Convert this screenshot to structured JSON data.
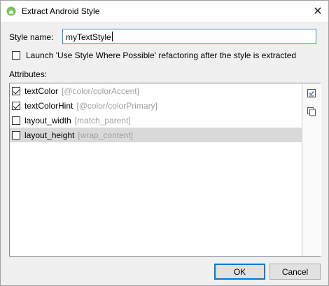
{
  "window": {
    "title": "Extract Android Style",
    "close_glyph": "✕"
  },
  "style_name": {
    "label": "Style name:",
    "value": "myTextStyle"
  },
  "launch_refactor": {
    "label": "Launch 'Use Style Where Possible' refactoring after the style is extracted",
    "checked": false
  },
  "attributes": {
    "label": "Attributes:",
    "items": [
      {
        "name": "textColor",
        "value": "[@color/colorAccent]",
        "checked": true,
        "selected": false
      },
      {
        "name": "textColorHint",
        "value": "[@color/colorPrimary]",
        "checked": true,
        "selected": false
      },
      {
        "name": "layout_width",
        "value": "[match_parent]",
        "checked": false,
        "selected": false
      },
      {
        "name": "layout_height",
        "value": "[wrap_content]",
        "checked": false,
        "selected": true
      }
    ]
  },
  "side_toolbar": {
    "icons": [
      "select-all-icon",
      "copy-icon"
    ]
  },
  "buttons": {
    "ok": "OK",
    "cancel": "Cancel"
  },
  "colors": {
    "accent_border": "#0078d7",
    "input_focus_border": "#3c8ed6",
    "selected_row": "#d9d9d9",
    "value_gray": "#a0a0a0",
    "android_green": "#78c257"
  }
}
